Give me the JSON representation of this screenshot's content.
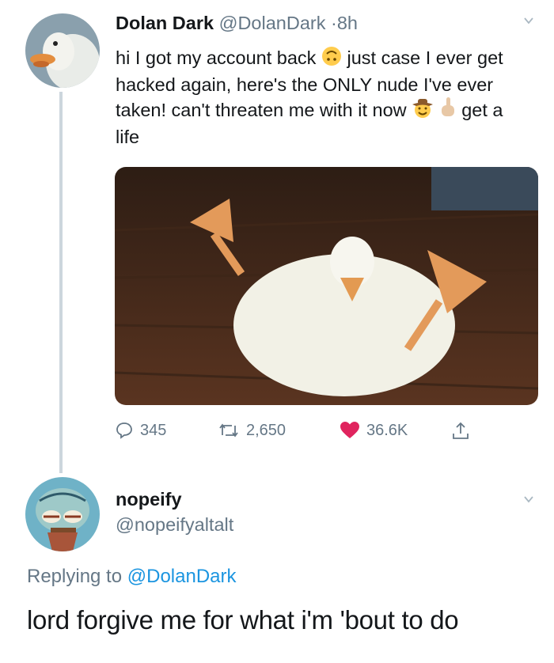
{
  "tweet": {
    "author_name": "Dolan Dark",
    "author_handle": "@DolanDark",
    "separator": "·",
    "time": "8h",
    "text_part1": "hi I got my account back",
    "text_part2": "just case I ever get hacked again, here's the ONLY nude I've ever taken! can't threaten me with it now",
    "text_part3": "get a life",
    "emojis": [
      "upside-down-face-emoji",
      "cowboy-face-emoji",
      "middle-finger-emoji"
    ],
    "media_icon": "duck-photo",
    "replies_count": "345",
    "retweets_count": "2,650",
    "likes_count": "36.6K",
    "colors": {
      "like": "#e0245e",
      "muted": "#657786",
      "thread_line": "#ccd6dd"
    }
  },
  "reply": {
    "author_name": "nopeify",
    "author_handle": "@nopeifyaltalt",
    "replying_to_prefix": "Replying to",
    "replying_to_handle": "@DolanDark",
    "text": "lord forgive me for what i'm 'bout to do",
    "colors": {
      "link": "#1b95e0"
    }
  }
}
